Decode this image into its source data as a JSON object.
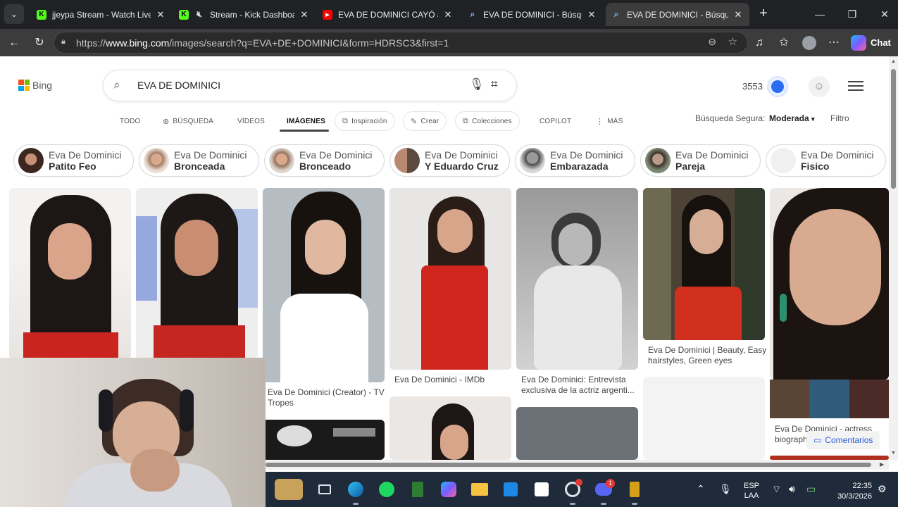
{
  "browser": {
    "tabs": [
      {
        "title": "jjeypa Stream - Watch Live o",
        "favicon": "kick-logo",
        "active": false
      },
      {
        "title": "Stream - Kick Dashboar",
        "favicon": "kick-logo",
        "muted": true,
        "active": false
      },
      {
        "title": "EVA DE DOMINICI CAYÓ al S",
        "favicon": "youtube-logo",
        "active": false
      },
      {
        "title": "EVA DE DOMINICI - Búsque",
        "favicon": "bing-search-icon",
        "active": false
      },
      {
        "title": "EVA DE DOMINICI - Búsque",
        "favicon": "bing-search-icon",
        "active": true
      }
    ],
    "url_prefix": "https://",
    "url_host": "www.bing.com",
    "url_path": "/images/search?q=EVA+DE+DOMINICI&form=HDRSC3&first=1",
    "chat_label": "Chat"
  },
  "bing": {
    "logo_text": "Bing",
    "query": "EVA DE DOMINICI",
    "rewards_points": "3553",
    "scopes": {
      "todo": "TODO",
      "busqueda": "BÚSQUEDA",
      "videos": "VÍDEOS",
      "imagenes": "IMÁGENES",
      "inspiracion": "Inspiración",
      "crear": "Crear",
      "colecciones": "Colecciones",
      "copilot": "COPILOT",
      "mas": "MÁS"
    },
    "safe_search_label": "Búsqueda Segura:",
    "safe_search_value": "Moderada",
    "filter_label": "Filtro",
    "chips": [
      {
        "line1": "Eva De Dominici",
        "line2": "Patito Feo"
      },
      {
        "line1": "Eva De Dominici",
        "line2": "Bronceada"
      },
      {
        "line1": "Eva De Dominici",
        "line2": "Bronceado"
      },
      {
        "line1": "Eva De Dominici",
        "line2": "Y Eduardo Cruz"
      },
      {
        "line1": "Eva De Dominici",
        "line2": "Embarazada"
      },
      {
        "line1": "Eva De Dominici",
        "line2": "Pareja"
      },
      {
        "line1": "Eva De Dominici",
        "line2": "Fisico"
      }
    ],
    "captions": {
      "tvtropes_1": "Eva De Dominici (Creator) - TV",
      "tvtropes_2": "Tropes",
      "imdb": "Eva De Dominici - IMDb",
      "entrevista_1": "Eva De Dominici: Entrevista",
      "entrevista_2": "exclusiva de la actriz argenti...",
      "beauty_1": "Eva De Dominici | Beauty, Easy",
      "beauty_2": "hairstyles, Green eyes",
      "actress_1": "Eva De Dominici - actress",
      "actress_2": "biograph"
    },
    "feedback_label": "Comentarios"
  },
  "taskbar": {
    "language_top": "ESP",
    "language_bottom": "LAA",
    "time": "22:35",
    "date": "30/3/2026",
    "discord_badge": "1"
  }
}
